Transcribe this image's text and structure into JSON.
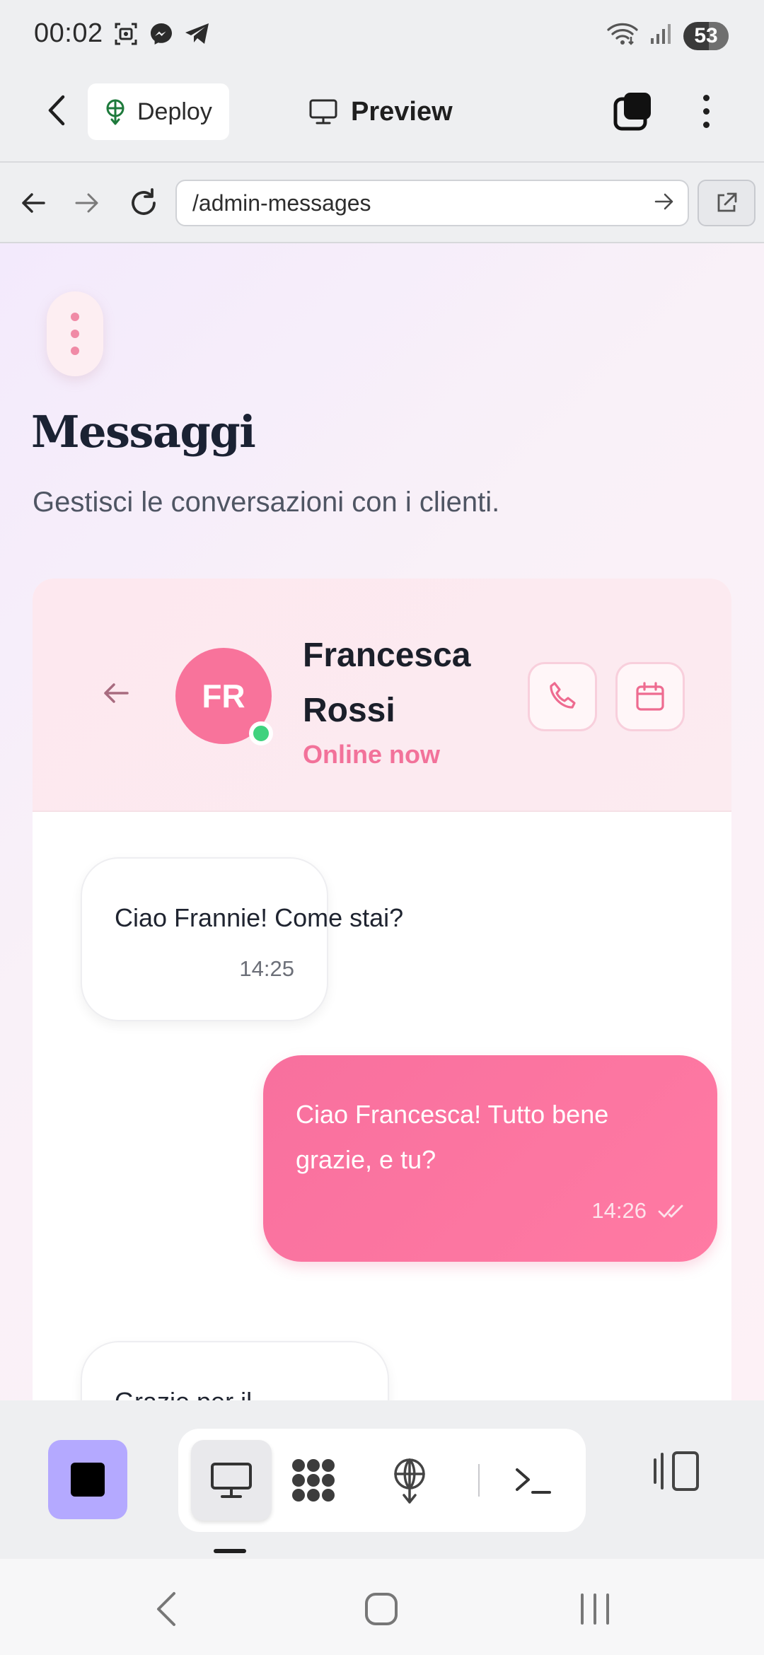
{
  "status_bar": {
    "time": "00:02",
    "battery": "53",
    "left_icons": [
      "screenshot-icon",
      "messenger-icon",
      "telegram-icon"
    ],
    "right_icons": [
      "wifi-icon",
      "signal-icon"
    ]
  },
  "app_header": {
    "deploy_label": "Deploy",
    "preview_label": "Preview"
  },
  "url_bar": {
    "url": "/admin-messages"
  },
  "page": {
    "title": "Messaggi",
    "subtitle": "Gestisci le conversazioni con i clienti."
  },
  "chat": {
    "avatar_initials": "FR",
    "contact_name": "Francesca Rossi",
    "contact_status": "Online now",
    "messages": [
      {
        "direction": "incoming",
        "text": "Ciao Frannie! Come stai?",
        "time": "14:25"
      },
      {
        "direction": "outgoing",
        "text": "Ciao Francesca! Tutto bene grazie, e tu?",
        "time": "14:26",
        "read": true
      },
      {
        "direction": "incoming",
        "text": "Grazie per il bellissimo lavoro! A presto",
        "time": ""
      }
    ]
  },
  "colors": {
    "accent_pink": "#f8739b",
    "online_green": "#3fd27e",
    "stop_button": "#b4a9ff",
    "title_ink": "#1b2233"
  }
}
